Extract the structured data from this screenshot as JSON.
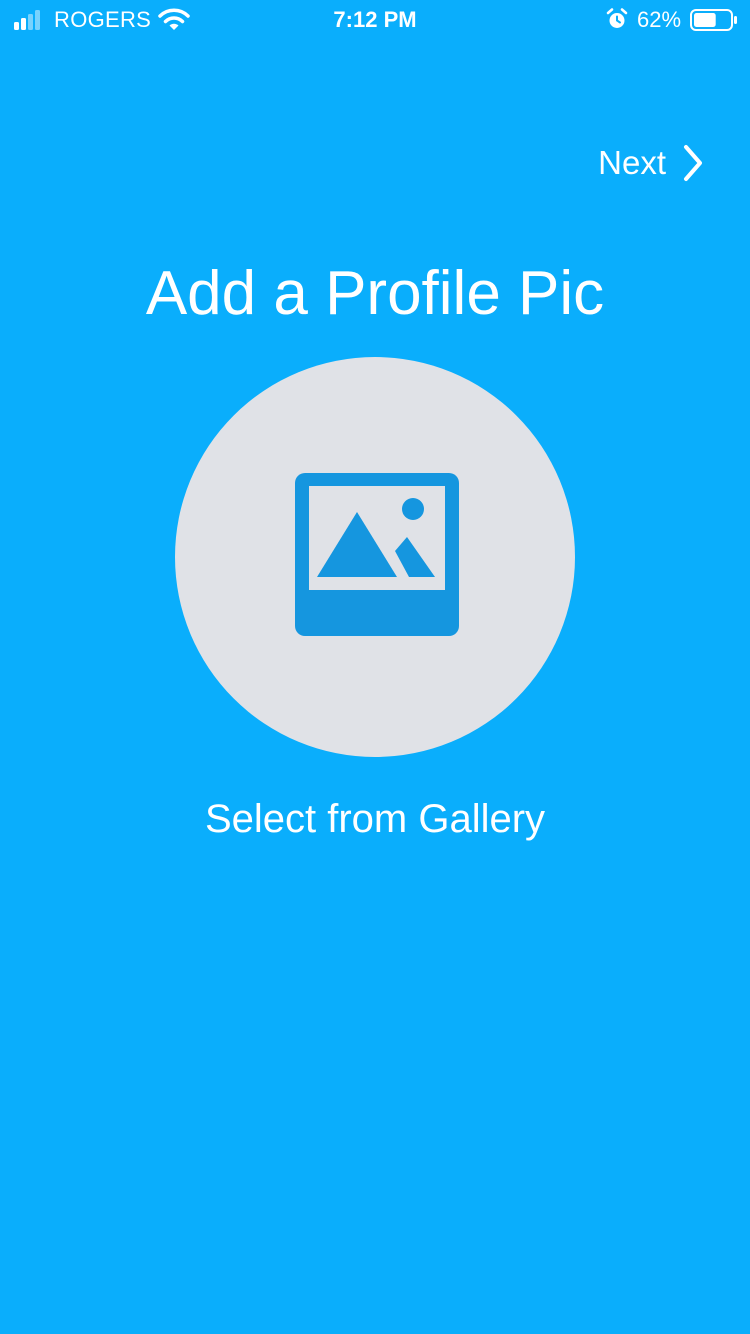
{
  "status_bar": {
    "carrier": "ROGERS",
    "time": "7:12 PM",
    "battery_percent": "62%",
    "battery_level": 0.62
  },
  "header": {
    "next_label": "Next"
  },
  "main": {
    "title": "Add a Profile Pic",
    "gallery_label": "Select from Gallery"
  },
  "icons": {
    "signal": "cellular-signal-icon",
    "wifi": "wifi-icon",
    "alarm": "alarm-clock-icon",
    "battery": "battery-icon",
    "next": "chevron-right-icon",
    "gallery": "image-gallery-icon"
  },
  "colors": {
    "background": "#0aaefc",
    "avatar_fill": "#e0e2e7",
    "icon_blue": "#1596df",
    "text": "#ffffff"
  }
}
